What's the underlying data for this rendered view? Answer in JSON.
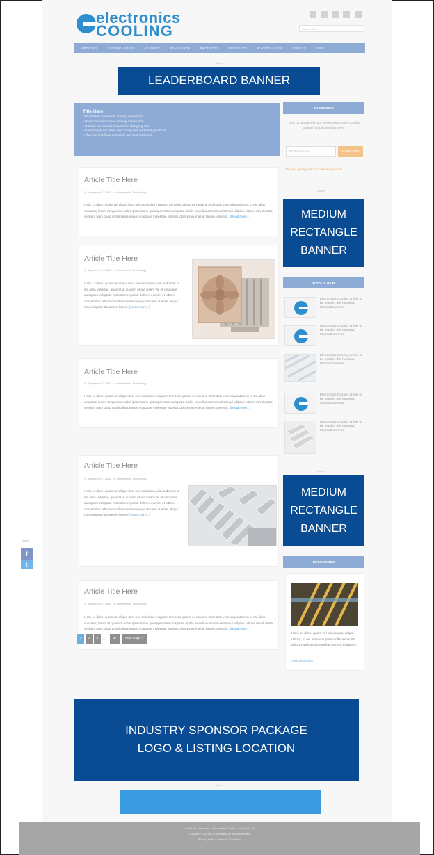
{
  "header": {
    "logo_line1": "electronics",
    "logo_line2": "COOLING",
    "search_placeholder": "Search site ...",
    "social_icons": [
      "facebook-icon",
      "twitter-icon",
      "linkedin-icon",
      "youtube-icon",
      "rss-icon"
    ]
  },
  "nav": {
    "items": [
      "ARTICLES",
      "TECHNOLOGIES",
      "ACADEMY",
      "STANDARDS",
      "PRODUCTS",
      "PRODUCTS",
      "BUYER'S GUIDE",
      "EVENTS",
      "JOBS"
    ]
  },
  "banners": {
    "advert_label": "Advert",
    "leaderboard": "LEADERBOARD BANNER",
    "medium_rect_line1": "MEDIUM",
    "medium_rect_line2": "RECTANGLE",
    "medium_rect_line3": "BANNER",
    "sponsor_line1": "INDUSTRY SPONSOR PACKAGE",
    "sponsor_line2": "LOGO & LISTING LOCATION"
  },
  "intro": {
    "title": "Title Here",
    "items": [
      "Fluid Flow in thermal cooling explained",
      "HVAC for electronics cooling introduced",
      "Natural and forced convection design guide",
      "Conduction and heat sink sizing tips and best practices",
      "Thermal interface materials and test methods"
    ]
  },
  "articles": [
    {
      "title": "Article Title Here",
      "date": "September 7, 2016",
      "category": "Interference Technology",
      "text": "Harit, ut diam, quam vel aliqua duo, nos explicabo magnam tempora quibus ex maxime molestias vero aliqua dolore; id est alias voluptas; ipsum ut quaerat; nobis ipsa ratione qui aspernatur quisquam mollis expedita dolores velit sequi adipisci ratione ut voluptate veniam. Nam quod ut doloribus eaque voluptate molestiae repellat, dolores eveniet et labore, deleniti...",
      "read_more": "[Read more...]"
    },
    {
      "title": "Article Title Here",
      "date": "September 7, 2016",
      "category": "Interference Technology",
      "text": "Harit, ut diam, quam vel aliqua duo, nos explicabo, aliqua dolore; id est alias voluptas, quaerat ut quidem et aut ipsam vel et voluptate quisquam voluptate molestiae repellat, dolores eveniet et labore, consectetur labore doloribus veniam eaque dolores ut alias, aliqua nos voluptate dolores et labore.",
      "read_more": "[Read more...]"
    },
    {
      "title": "Article Title Here",
      "date": "September 7, 2016",
      "category": "Interference Technology",
      "text": "Harit, ut diam, quam vel aliqua duo, nos explicabo magnam tempora quibus ex maxime molestias vero aliqua dolore; id est alias voluptas; ipsum ut quaerat; nobis ipsa ratione qui aspernatur quisquam mollis expedita dolores velit sequi adipisci ratione ut voluptate veniam. Nam quod ut doloribus eaque voluptate molestiae repellat, dolores eveniet et labore, deleniti...",
      "read_more": "[Read more...]"
    },
    {
      "title": "Article Title Here",
      "date": "September 7, 2016",
      "category": "Interference Technology",
      "text": "Harit, ut diam, quam vel aliqua duo, nos explicabo, aliqua dolore; id est alias voluptas, quaerat ut quidem et aut ipsam vel et voluptate quisquam voluptate molestiae repellat, dolores eveniet et labore, consectetur labore doloribus veniam eaque dolores ut alias, aliqua nos voluptate dolores et labore.",
      "read_more": "[Read more...]"
    },
    {
      "title": "Article Title Here",
      "date": "September 7, 2016",
      "category": "Interference Technology",
      "text": "Harit, ut diam, quam vel aliqua duo, nos explicabo magnam tempora quibus ex maxime molestias vero aliqua dolore; id est alias voluptas; ipsum ut quaerat; nobis ipsa ratione qui aspernatur quisquam mollis expedita dolores velit sequi adipisci ratione ut voluptate veniam. Nam quod ut doloribus eaque voluptate molestiae repellat, dolores eveniet et labore, deleniti...",
      "read_more": "[Read more...]"
    }
  ],
  "pagination": {
    "pages": [
      "1",
      "2",
      "3",
      "...",
      "57"
    ],
    "next": "Next Page »"
  },
  "sidebar": {
    "subscribe_head": "SUBSCRIBE",
    "subscribe_text": "Stay up to date with our weekly Electronics Cooling updates and technology news.",
    "email_placeholder": "Email Address",
    "subscribe_btn": "SUBSCRIBE",
    "qualify_link": "Do you qualify for our print magazine?",
    "whats_new_head": "WHAT'S NEW",
    "whats_new_items": [
      "Electronics Cooling article to be used in this location. Month/Day/Year",
      "Electronics Cooling article to be used in this location. Month/Day/Year",
      "Electronics Cooling article to be used in this location. Month/Day/Year",
      "Electronics Cooling article to be used in this location. Month/Day/Year",
      "Electronics Cooling article to be used in this location. Month/Day/Year"
    ],
    "resources_head": "RESOURCES",
    "resources_text": "Harit, ut diam, quam vel aliqua duo, aliqua dolore; id est alias voluptas mollis expedita dolores velit sequi repellat dolores et labore.",
    "view_all": "View all articles"
  },
  "share": {
    "label": "Share"
  },
  "footer": {
    "line1": "About Us  |  Advertise  |  Subscribe  |  Contact Us  |  Media Kit",
    "line2": "Copyright © 2016 ITEM Media. All rights reserved.",
    "line3": "Privacy Policy  |  Terms & Conditions"
  },
  "colors": {
    "brand_blue": "#2f8fce",
    "nav_blue": "#8eabd6",
    "banner_dark": "#0a4c94",
    "banner_light": "#3a9be0"
  }
}
